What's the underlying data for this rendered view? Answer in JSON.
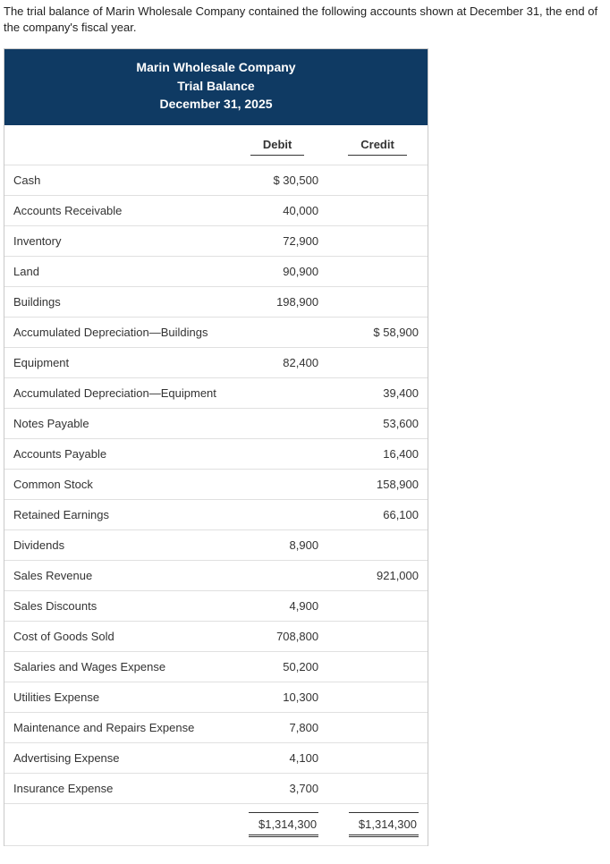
{
  "intro": "The trial balance of Marin Wholesale Company contained the following accounts shown at December 31, the end of the company's fiscal year.",
  "header": {
    "company": "Marin Wholesale Company",
    "title": "Trial Balance",
    "date": "December 31, 2025"
  },
  "columns": {
    "debit": "Debit",
    "credit": "Credit"
  },
  "rows": [
    {
      "account": "Cash",
      "debit": "$ 30,500",
      "credit": ""
    },
    {
      "account": "Accounts Receivable",
      "debit": "40,000",
      "credit": ""
    },
    {
      "account": "Inventory",
      "debit": "72,900",
      "credit": ""
    },
    {
      "account": "Land",
      "debit": "90,900",
      "credit": ""
    },
    {
      "account": "Buildings",
      "debit": "198,900",
      "credit": ""
    },
    {
      "account": "Accumulated Depreciation—Buildings",
      "debit": "",
      "credit": "$ 58,900"
    },
    {
      "account": "Equipment",
      "debit": "82,400",
      "credit": ""
    },
    {
      "account": "Accumulated Depreciation—Equipment",
      "debit": "",
      "credit": "39,400"
    },
    {
      "account": "Notes Payable",
      "debit": "",
      "credit": "53,600"
    },
    {
      "account": "Accounts Payable",
      "debit": "",
      "credit": "16,400"
    },
    {
      "account": "Common Stock",
      "debit": "",
      "credit": "158,900"
    },
    {
      "account": "Retained Earnings",
      "debit": "",
      "credit": "66,100"
    },
    {
      "account": "Dividends",
      "debit": "8,900",
      "credit": ""
    },
    {
      "account": "Sales Revenue",
      "debit": "",
      "credit": "921,000"
    },
    {
      "account": "Sales Discounts",
      "debit": "4,900",
      "credit": ""
    },
    {
      "account": "Cost of Goods Sold",
      "debit": "708,800",
      "credit": ""
    },
    {
      "account": "Salaries and Wages Expense",
      "debit": "50,200",
      "credit": ""
    },
    {
      "account": "Utilities Expense",
      "debit": "10,300",
      "credit": ""
    },
    {
      "account": "Maintenance and Repairs Expense",
      "debit": "7,800",
      "credit": ""
    },
    {
      "account": "Advertising Expense",
      "debit": "4,100",
      "credit": ""
    },
    {
      "account": "Insurance Expense",
      "debit": "3,700",
      "credit": ""
    }
  ],
  "totals": {
    "debit": "$1,314,300",
    "credit": "$1,314,300"
  }
}
